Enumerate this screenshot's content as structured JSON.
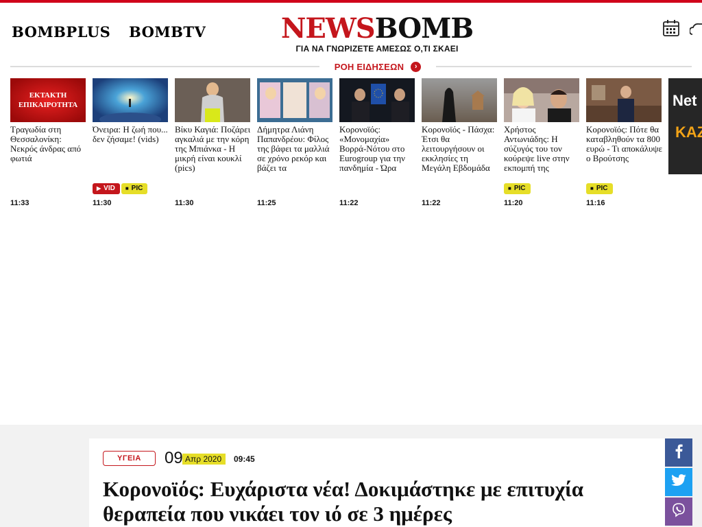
{
  "header": {
    "nav": [
      {
        "label": "BOMBPLUS"
      },
      {
        "label": "BOMBTV"
      }
    ],
    "logo": {
      "part1": "NEWS",
      "part2": "BOMB",
      "tagline": "ΓΙΑ ΝΑ ΓΝΩΡΙΖΕΤΕ ΑΜΕΣΩΣ Ο,ΤΙ ΣΚΑΕΙ"
    },
    "icons": [
      "calendar-icon",
      "weather-cloud-icon"
    ]
  },
  "news_feed": {
    "label": "ΡΟΗ ΕΙΔΗΣΕΩΝ",
    "arrow_icon": "chevron-right-icon"
  },
  "ticker": [
    {
      "thumb_text": "ΕΚΤΑΚΤΗ ΕΠΙΚΑΙΡΟΤΗΤΑ",
      "title": "Τραγωδία στη Θεσσαλονίκη: Νεκρός άνδρας από φωτιά",
      "time": "11:33",
      "badges": []
    },
    {
      "title": "Όνειρα: Η ζωή που... δεν ζήσαμε! (vids)",
      "time": "11:30",
      "badges": [
        "VID",
        "PIC"
      ]
    },
    {
      "title": "Βίκυ Καγιά: Ποζάρει αγκαλιά με την κόρη της Μπιάνκα - Η μικρή είναι κουκλί (pics)",
      "time": "11:30",
      "badges": []
    },
    {
      "title": "Δήμητρα Λιάνη Παπανδρέου: Φίλος της βάφει τα μαλλιά σε χρόνο ρεκόρ και βάζει τα",
      "time": "11:25",
      "badges": []
    },
    {
      "title": "Κορονοϊός: «Μονομαχία» Βορρά-Νότου στο Eurogroup για την πανδημία - Ώρα",
      "time": "11:22",
      "badges": []
    },
    {
      "title": "Κορονοϊός - Πάσχα: Έτσι θα λειτουργήσουν οι εκκλησίες τη Μεγάλη Εβδομάδα",
      "time": "11:22",
      "badges": []
    },
    {
      "title": "Χρήστος Αντωνιάδης: Η σύζυγός του τον κούρεψε live στην εκπομπή της",
      "time": "11:20",
      "badges": [
        "PIC"
      ]
    },
    {
      "title": "Κορονοϊός: Πότε θα καταβληθούν τα 800 ευρώ - Τι αποκάλυψε ο Βρούτσης",
      "time": "11:16",
      "badges": [
        "PIC"
      ]
    }
  ],
  "ad": {
    "line1": "Net",
    "line2": "KAZ"
  },
  "article": {
    "category": "ΥΓΕΙΑ",
    "day": "09",
    "month": "Απρ 2020",
    "time": "09:45",
    "headline": "Κορονοϊός: Ευχάριστα νέα! Δοκιμάστηκε με επιτυχία θεραπεία που νικάει τον ιό σε 3 ημέρες"
  },
  "share": [
    "facebook-icon",
    "twitter-icon",
    "viber-icon"
  ],
  "colors": {
    "brand_red": "#c4161c",
    "badge_yellow": "#e6de28",
    "facebook": "#3b5998",
    "twitter": "#1da1f2",
    "viber": "#7b519d"
  }
}
